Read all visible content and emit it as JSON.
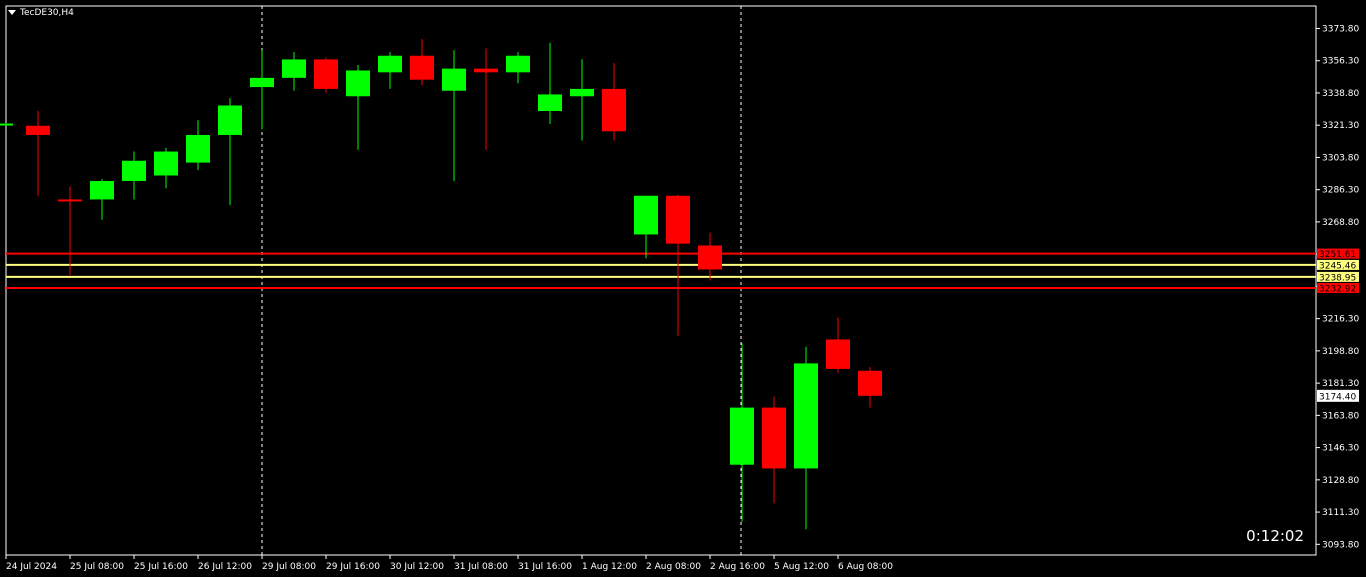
{
  "window": {
    "title": "TecDE30,H4",
    "timer": "0:12:02"
  },
  "colors": {
    "background": "#000000",
    "bull": "#00ff00",
    "bear": "#ff0000",
    "axis": "#ffffff",
    "red_line": "#ff0000",
    "yellow_line": "#ffff80"
  },
  "chart_data": {
    "type": "candlestick",
    "symbol": "TecDE30",
    "timeframe": "H4",
    "ylim": [
      3088,
      3386
    ],
    "y_ticks": [
      "3373.80",
      "3356.30",
      "3338.80",
      "3321.30",
      "3303.80",
      "3286.30",
      "3268.80",
      "3251.30",
      "3233.80",
      "3216.30",
      "3198.80",
      "3181.30",
      "3163.80",
      "3146.30",
      "3128.80",
      "3111.30",
      "3093.80"
    ],
    "x_ticks": [
      "24 Jul 2024",
      "25 Jul 08:00",
      "25 Jul 16:00",
      "26 Jul 12:00",
      "29 Jul 08:00",
      "29 Jul 16:00",
      "30 Jul 12:00",
      "31 Jul 08:00",
      "31 Jul 16:00",
      "1 Aug 12:00",
      "2 Aug 08:00",
      "2 Aug 16:00",
      "5 Aug 12:00",
      "6 Aug 08:00"
    ],
    "session_separators": [
      "29 Jul",
      "5 Aug"
    ],
    "candles": [
      {
        "o": 3322.0,
        "h": 3322.5,
        "l": 3321.0,
        "c": 3322.2
      },
      {
        "o": 3321.0,
        "h": 3329.0,
        "l": 3283.0,
        "c": 3316.0
      },
      {
        "o": 3281.0,
        "h": 3288.0,
        "l": 3240.0,
        "c": 3280.0
      },
      {
        "o": 3281.0,
        "h": 3292.0,
        "l": 3270.0,
        "c": 3291.0
      },
      {
        "o": 3291.0,
        "h": 3307.0,
        "l": 3281.0,
        "c": 3302.0
      },
      {
        "o": 3294.0,
        "h": 3309.0,
        "l": 3287.0,
        "c": 3307.0
      },
      {
        "o": 3301.0,
        "h": 3324.0,
        "l": 3297.0,
        "c": 3316.0
      },
      {
        "o": 3316.0,
        "h": 3336.0,
        "l": 3278.0,
        "c": 3332.0
      },
      {
        "o": 3342.0,
        "h": 3362.0,
        "l": 3319.0,
        "c": 3347.0
      },
      {
        "o": 3347.0,
        "h": 3361.0,
        "l": 3340.0,
        "c": 3357.0
      },
      {
        "o": 3357.0,
        "h": 3358.0,
        "l": 3339.0,
        "c": 3341.0
      },
      {
        "o": 3337.0,
        "h": 3354.0,
        "l": 3308.0,
        "c": 3351.0
      },
      {
        "o": 3350.0,
        "h": 3361.0,
        "l": 3341.0,
        "c": 3359.0
      },
      {
        "o": 3359.0,
        "h": 3368.0,
        "l": 3343.0,
        "c": 3346.0
      },
      {
        "o": 3340.0,
        "h": 3362.0,
        "l": 3291.0,
        "c": 3352.0
      },
      {
        "o": 3352.0,
        "h": 3363.0,
        "l": 3308.0,
        "c": 3350.0
      },
      {
        "o": 3350.0,
        "h": 3361.0,
        "l": 3344.0,
        "c": 3359.0
      },
      {
        "o": 3329.0,
        "h": 3366.0,
        "l": 3322.0,
        "c": 3338.0
      },
      {
        "o": 3337.0,
        "h": 3357.0,
        "l": 3313.0,
        "c": 3341.0
      },
      {
        "o": 3341.0,
        "h": 3355.0,
        "l": 3313.0,
        "c": 3318.0
      },
      {
        "o": 3262.0,
        "h": 3283.0,
        "l": 3249.0,
        "c": 3283.0
      },
      {
        "o": 3283.0,
        "h": 3283.5,
        "l": 3207.0,
        "c": 3257.0
      },
      {
        "o": 3256.0,
        "h": 3263.0,
        "l": 3237.0,
        "c": 3243.0
      },
      {
        "o": 3137.0,
        "h": 3203.0,
        "l": 3106.0,
        "c": 3168.0
      },
      {
        "o": 3168.0,
        "h": 3174.0,
        "l": 3116.0,
        "c": 3135.0
      },
      {
        "o": 3135.0,
        "h": 3201.0,
        "l": 3102.0,
        "c": 3192.0
      },
      {
        "o": 3205.0,
        "h": 3217.0,
        "l": 3187.0,
        "c": 3189.0
      },
      {
        "o": 3188.0,
        "h": 3190.0,
        "l": 3168.0,
        "c": 3174.4
      }
    ],
    "hlines": [
      {
        "price": 3251.61,
        "label": "3251.61",
        "color": "#ff0000"
      },
      {
        "price": 3245.46,
        "label": "3245.46",
        "color": "#ffff80"
      },
      {
        "price": 3238.95,
        "label": "3238.95",
        "color": "#ffff80"
      },
      {
        "price": 3232.92,
        "label": "3232.92",
        "color": "#ff0000"
      }
    ],
    "current_price": "3174.40"
  }
}
